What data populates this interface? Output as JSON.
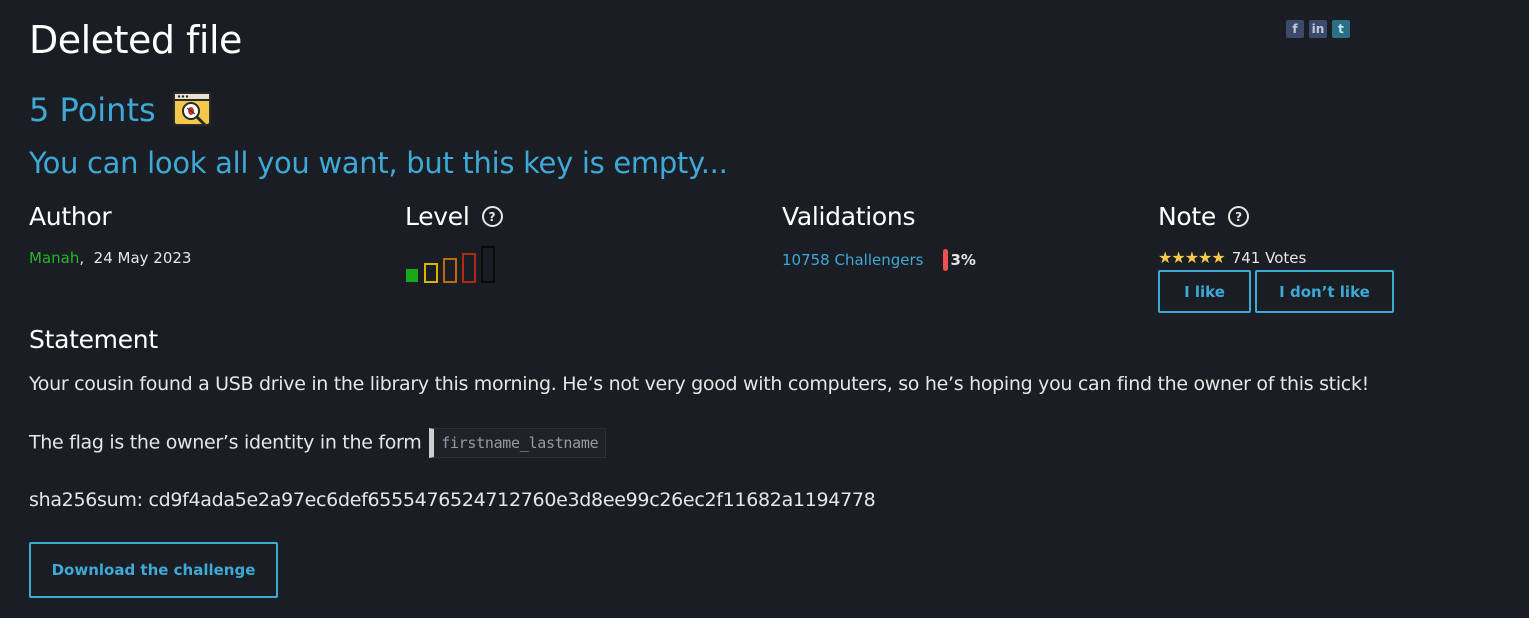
{
  "page": {
    "title": "Deleted file",
    "points": "5 Points",
    "subtitle": "You can look all you want, but this key is empty..."
  },
  "social": {
    "facebook_icon_glyph": "f",
    "linkedin_icon_glyph": "in",
    "twitter_icon_glyph": "t"
  },
  "author": {
    "heading": "Author",
    "name": "Manah",
    "separator": ",",
    "date": "24 May 2023"
  },
  "level": {
    "heading": "Level",
    "help_glyph": "?",
    "current": 1,
    "max": 5,
    "colors": [
      "#17a917",
      "#d4b800",
      "#c06a10",
      "#b02a18",
      "#000000"
    ]
  },
  "validations": {
    "heading": "Validations",
    "challengers": "10758 Challengers",
    "percent": "3%"
  },
  "note": {
    "heading": "Note",
    "help_glyph": "?",
    "stars": "★★★★★",
    "votes": "741 Votes",
    "like_label": "I like",
    "dislike_label": "I don’t like"
  },
  "statement": {
    "heading": "Statement",
    "paragraph1": "Your cousin found a USB drive in the library this morning. He’s not very good with computers, so he’s hoping you can find the owner of this stick!",
    "flag_text": "The flag is the owner’s identity in the form",
    "flag_format": "firstname_lastname",
    "sha_line": "sha256sum: cd9f4ada5e2a97ec6def6555476524712760e3d8ee99c26ec2f11682a1194778"
  },
  "download_label": "Download the challenge",
  "colors": {
    "background": "#1a1d23",
    "accent": "#3fa9d6",
    "author_green": "#27b427",
    "star_yellow": "#f2c94c",
    "percent_red": "#f05050"
  },
  "icons": {
    "category": "forensics-bug-magnifier-icon",
    "help": "question-circle-icon"
  }
}
